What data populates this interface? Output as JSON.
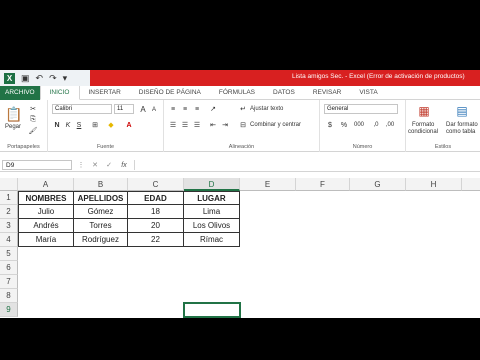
{
  "title": {
    "app_icon": "X",
    "text": "Lista amigos Sec. - Excel (Error de activación de productos)"
  },
  "tabs": [
    "ARCHIVO",
    "INICIO",
    "INSERTAR",
    "DISEÑO DE PÁGINA",
    "FÓRMULAS",
    "DATOS",
    "REVISAR",
    "VISTA"
  ],
  "ribbon": {
    "paste_label": "Pegar",
    "font_name": "Calibri",
    "font_size": "11",
    "wrap_text": "Ajustar texto",
    "merge_center": "Combinar y centrar",
    "number_format": "General",
    "cond_format_1": "Formato",
    "cond_format_2": "condicional",
    "table_format_1": "Dar formato",
    "table_format_2": "como tabla",
    "groups": [
      "Portapapeles",
      "Fuente",
      "Alineación",
      "Número",
      "Estilos"
    ]
  },
  "formula_bar": {
    "name_box": "D9",
    "fx": "fx",
    "value": ""
  },
  "sheet": {
    "columns": [
      "A",
      "B",
      "C",
      "D",
      "E",
      "F",
      "G",
      "H"
    ],
    "rows": [
      "1",
      "2",
      "3",
      "4",
      "5",
      "6",
      "7",
      "8",
      "9"
    ],
    "table": [
      [
        "NOMBRES",
        "APELLIDOS",
        "EDAD",
        "LUGAR"
      ],
      [
        "Julio",
        "Gómez",
        "18",
        "Lima"
      ],
      [
        "Andrés",
        "Torres",
        "20",
        "Los Olivos"
      ],
      [
        "María",
        "Rodríguez",
        "22",
        "Rímac"
      ]
    ],
    "active_cell": "D9",
    "selected_column": "D",
    "selected_row": "9"
  },
  "colors": {
    "excel_green": "#217346",
    "title_red": "#d82020"
  }
}
